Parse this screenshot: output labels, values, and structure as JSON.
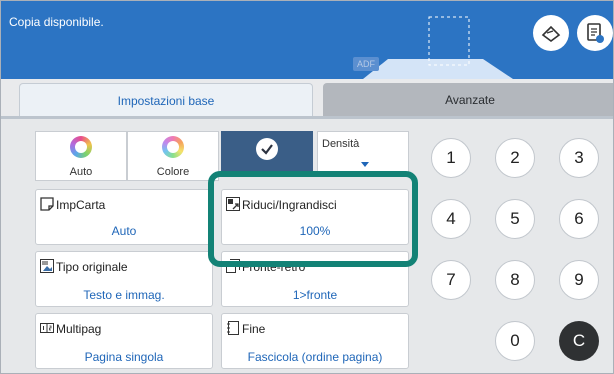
{
  "status": {
    "message": "Copia disponibile."
  },
  "scanner": {
    "adf_label": "ADF"
  },
  "header_icons": {
    "left": "scan-settings-icon",
    "right": "job-settings-icon"
  },
  "tabs": [
    {
      "label": "Impostazioni base",
      "active": true
    },
    {
      "label": "Avanzate",
      "active": false
    }
  ],
  "color_mode": {
    "options": [
      {
        "label": "Auto"
      },
      {
        "label": "Colore"
      }
    ]
  },
  "density": {
    "label": "Densità"
  },
  "settings": {
    "paper": {
      "title": "ImpCarta",
      "value": "Auto"
    },
    "zoom": {
      "title": "Riduci/Ingrandisci",
      "value": "100%"
    },
    "original_type": {
      "title": "Tipo originale",
      "value": "Testo e immag."
    },
    "duplex": {
      "title": "Fronte-retro",
      "value": "1>fronte"
    },
    "multipage": {
      "title": "Multipag",
      "value": "Pagina singola"
    },
    "finish": {
      "title": "Fine",
      "value": "Fascicola (ordine pagina)"
    }
  },
  "keypad": {
    "keys": [
      "1",
      "2",
      "3",
      "4",
      "5",
      "6",
      "7",
      "8",
      "9",
      "0",
      "C"
    ]
  },
  "colors": {
    "header": "#2c74c3",
    "accent": "#1f66b8",
    "highlight": "#138276",
    "selected": "#3a5e87"
  }
}
